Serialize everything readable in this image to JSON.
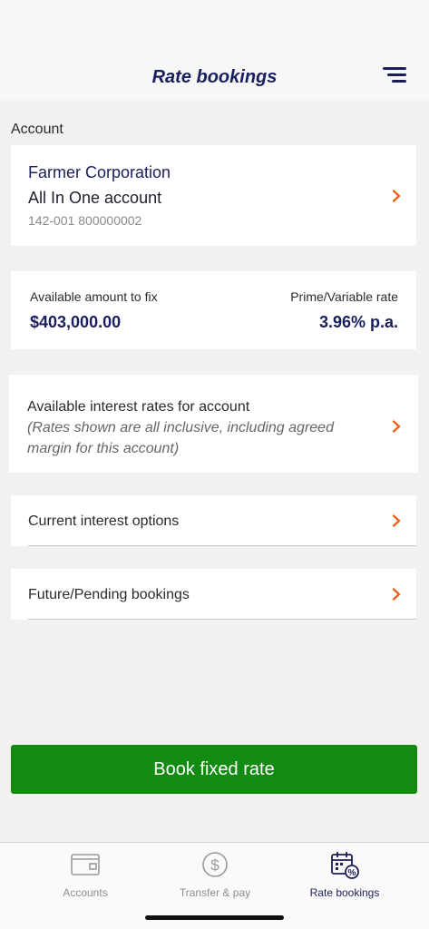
{
  "header": {
    "title": "Rate bookings",
    "menu_icon": "hamburger-menu-icon"
  },
  "account_section": {
    "label": "Account",
    "name": "Farmer Corporation",
    "type": "All In One account",
    "number": "142-001 800000002"
  },
  "amounts": {
    "available_label": "Available amount to fix",
    "available_value": "$403,000.00",
    "rate_label": "Prime/Variable rate",
    "rate_value": "3.96% p.a."
  },
  "rates": {
    "title": "Available interest rates for account",
    "note": "(Rates shown are all inclusive, including agreed margin for this account)"
  },
  "rows": {
    "current": "Current interest options",
    "future": "Future/Pending bookings"
  },
  "book_button": {
    "label": "Book fixed rate"
  },
  "tabs": [
    {
      "label": "Accounts",
      "icon": "wallet-icon"
    },
    {
      "label": "Transfer & pay",
      "icon": "dollar-circle-icon"
    },
    {
      "label": "Rate bookings",
      "icon": "calendar-percent-icon",
      "active": true
    }
  ],
  "colors": {
    "brand_navy": "#1a1f5c",
    "accent_orange": "#e8611a",
    "button_green": "#138a12",
    "background": "#f2f1ef"
  }
}
